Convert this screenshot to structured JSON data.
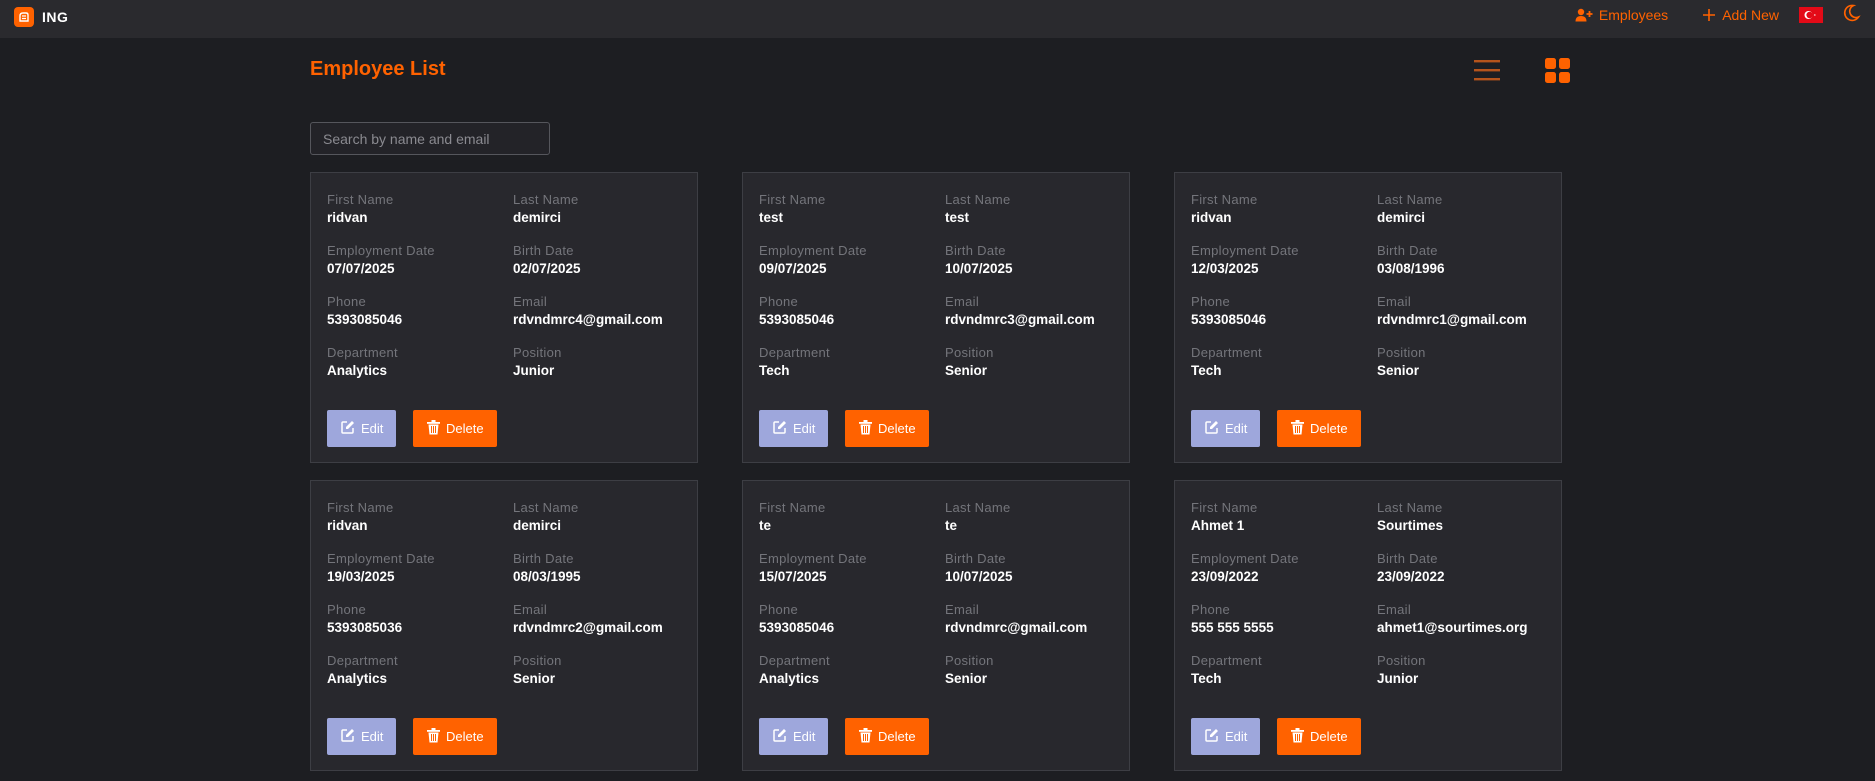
{
  "brand": {
    "name": "ING"
  },
  "nav": {
    "employees_label": "Employees",
    "add_new_label": "Add New"
  },
  "page": {
    "title": "Employee List"
  },
  "search": {
    "placeholder": "Search by name and email",
    "value": ""
  },
  "labels": {
    "first_name": "First Name",
    "last_name": "Last Name",
    "employment_date": "Employment Date",
    "birth_date": "Birth Date",
    "phone": "Phone",
    "email": "Email",
    "department": "Department",
    "position": "Position",
    "edit": "Edit",
    "delete": "Delete"
  },
  "colors": {
    "accent": "#ff6200",
    "edit_button": "#9ea7dc",
    "background": "#1d1e22",
    "card": "#28282d"
  },
  "icons": {
    "brand": "ing-lion-icon",
    "employees": "user-plus-icon",
    "add_new": "plus-icon",
    "language": "turkey-flag-icon",
    "theme": "moon-icon",
    "list_view": "list-view-icon",
    "grid_view": "grid-view-icon",
    "edit": "edit-icon",
    "delete": "trash-icon"
  },
  "employees": [
    {
      "first_name": "ridvan",
      "last_name": "demirci",
      "employment_date": "07/07/2025",
      "birth_date": "02/07/2025",
      "phone": "5393085046",
      "email": "rdvndmrc4@gmail.com",
      "department": "Analytics",
      "position": "Junior"
    },
    {
      "first_name": "test",
      "last_name": "test",
      "employment_date": "09/07/2025",
      "birth_date": "10/07/2025",
      "phone": "5393085046",
      "email": "rdvndmrc3@gmail.com",
      "department": "Tech",
      "position": "Senior"
    },
    {
      "first_name": "ridvan",
      "last_name": "demirci",
      "employment_date": "12/03/2025",
      "birth_date": "03/08/1996",
      "phone": "5393085046",
      "email": "rdvndmrc1@gmail.com",
      "department": "Tech",
      "position": "Senior"
    },
    {
      "first_name": "ridvan",
      "last_name": "demirci",
      "employment_date": "19/03/2025",
      "birth_date": "08/03/1995",
      "phone": "5393085036",
      "email": "rdvndmrc2@gmail.com",
      "department": "Analytics",
      "position": "Senior"
    },
    {
      "first_name": "te",
      "last_name": "te",
      "employment_date": "15/07/2025",
      "birth_date": "10/07/2025",
      "phone": "5393085046",
      "email": "rdvndmrc@gmail.com",
      "department": "Analytics",
      "position": "Senior"
    },
    {
      "first_name": "Ahmet 1",
      "last_name": "Sourtimes",
      "employment_date": "23/09/2022",
      "birth_date": "23/09/2022",
      "phone": "555 555 5555",
      "email": "ahmet1@sourtimes.org",
      "department": "Tech",
      "position": "Junior"
    }
  ]
}
